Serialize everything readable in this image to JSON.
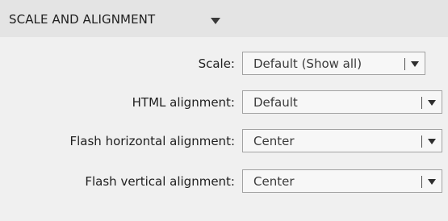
{
  "section": {
    "title": "SCALE AND ALIGNMENT",
    "collapse_icon": "triangle-down-icon"
  },
  "fields": [
    {
      "label": "Scale:",
      "value": "Default (Show all)"
    },
    {
      "label": "HTML alignment:",
      "value": "Default"
    },
    {
      "label": "Flash horizontal alignment:",
      "value": "Center"
    },
    {
      "label": "Flash vertical alignment:",
      "value": "Center"
    }
  ],
  "dropdown_icon": "triangle-down-icon"
}
